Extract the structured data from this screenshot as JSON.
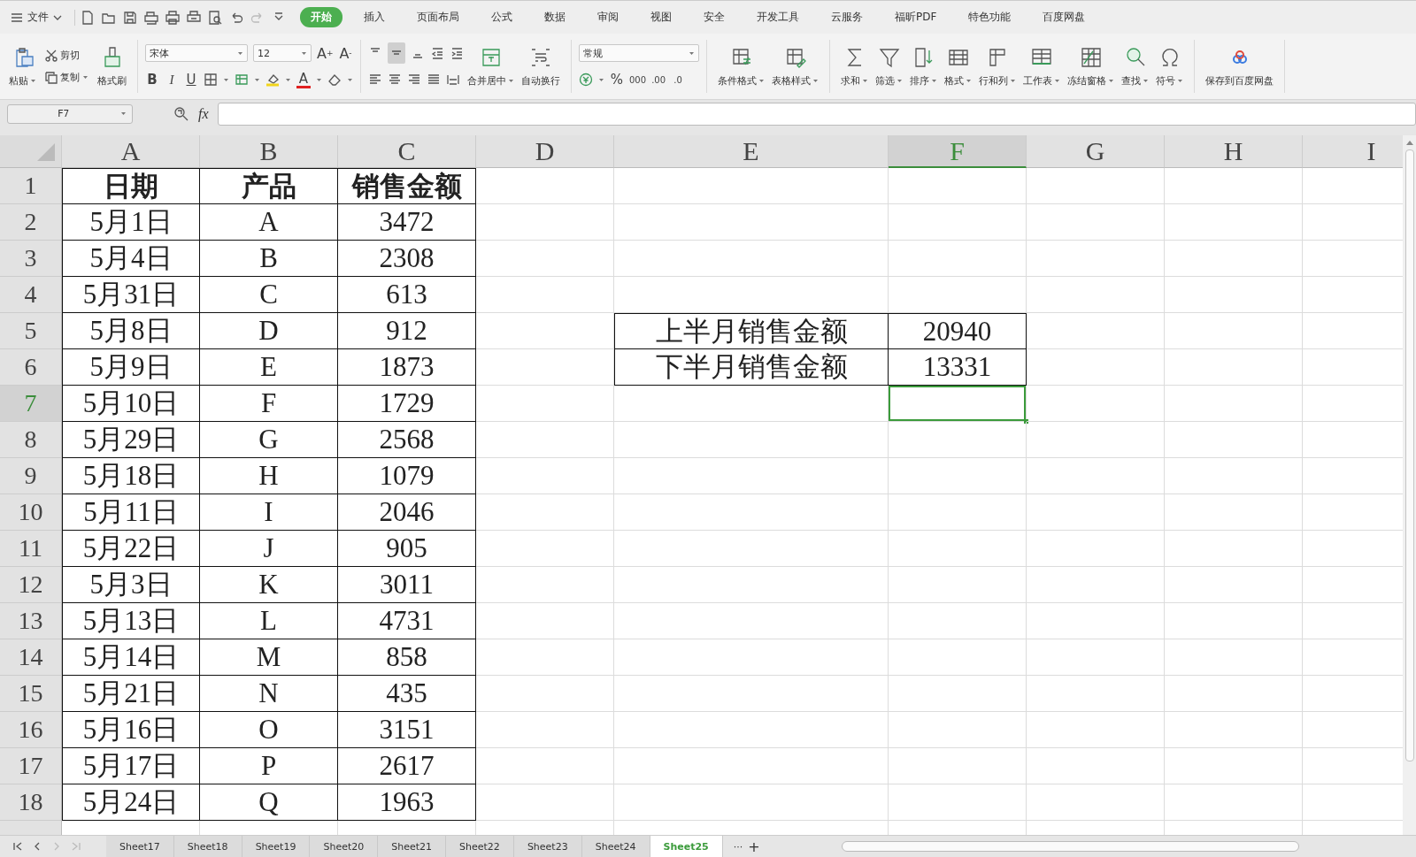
{
  "menu": {
    "file_label": "文件",
    "tabs": [
      {
        "label": "开始",
        "selected": true
      },
      {
        "label": "插入",
        "selected": false
      },
      {
        "label": "页面布局",
        "selected": false
      },
      {
        "label": "公式",
        "selected": false
      },
      {
        "label": "数据",
        "selected": false
      },
      {
        "label": "审阅",
        "selected": false
      },
      {
        "label": "视图",
        "selected": false
      },
      {
        "label": "安全",
        "selected": false
      },
      {
        "label": "开发工具",
        "selected": false
      },
      {
        "label": "云服务",
        "selected": false
      },
      {
        "label": "福昕PDF",
        "selected": false
      },
      {
        "label": "特色功能",
        "selected": false
      },
      {
        "label": "百度网盘",
        "selected": false
      }
    ]
  },
  "toolbar": {
    "paste": "粘贴",
    "cut": "剪切",
    "copy": "复制",
    "format_painter": "格式刷",
    "font_name": "宋体",
    "font_size": "12",
    "grow_font": "A$^{+}$",
    "shrink_font": "A$^{-}$",
    "bold": "B",
    "italic": "I",
    "underline": "U",
    "font_color": "A",
    "merge": "合并居中",
    "wrap": "自动换行",
    "number_format": "常规",
    "percent": "%",
    "thousands": "000",
    "add_decimal": ".00",
    "remove_decimal": ".0",
    "groups": [
      {
        "label": "条件格式",
        "dropdown": true
      },
      {
        "label": "表格样式",
        "dropdown": true
      }
    ],
    "tools": [
      {
        "label": "求和",
        "dropdown": true
      },
      {
        "label": "筛选",
        "dropdown": true
      },
      {
        "label": "排序",
        "dropdown": true
      },
      {
        "label": "格式",
        "dropdown": true
      },
      {
        "label": "行和列",
        "dropdown": true
      },
      {
        "label": "工作表",
        "dropdown": true
      },
      {
        "label": "冻结窗格",
        "dropdown": true
      },
      {
        "label": "查找",
        "dropdown": true
      },
      {
        "label": "符号",
        "dropdown": true
      }
    ],
    "save": "保存到百度网盘"
  },
  "formula_bar": {
    "name_box": "F7",
    "fx": "fx"
  },
  "columns": [
    {
      "label": "A",
      "selected": false
    },
    {
      "label": "B",
      "selected": false
    },
    {
      "label": "C",
      "selected": false
    },
    {
      "label": "D",
      "selected": false
    },
    {
      "label": "E",
      "selected": false
    },
    {
      "label": "F",
      "selected": true
    },
    {
      "label": "G",
      "selected": false
    },
    {
      "label": "H",
      "selected": false
    },
    {
      "label": "I",
      "selected": false
    }
  ],
  "rows": [
    {
      "number": "1",
      "selected": false,
      "kind": "header",
      "table": [
        "日期",
        "产品",
        "销售金额"
      ]
    },
    {
      "number": "2",
      "selected": false,
      "table": [
        "5月1日",
        "A",
        "3472"
      ]
    },
    {
      "number": "3",
      "selected": false,
      "table": [
        "5月4日",
        "B",
        "2308"
      ]
    },
    {
      "number": "4",
      "selected": false,
      "table": [
        "5月31日",
        "C",
        "613"
      ]
    },
    {
      "number": "5",
      "selected": false,
      "table": [
        "5月8日",
        "D",
        "912"
      ],
      "summary": [
        "上半月销售金额",
        "20940"
      ]
    },
    {
      "number": "6",
      "selected": false,
      "table": [
        "5月9日",
        "E",
        "1873"
      ],
      "summary": [
        "下半月销售金额",
        "13331"
      ]
    },
    {
      "number": "7",
      "selected": true,
      "table": [
        "5月10日",
        "F",
        "1729"
      ]
    },
    {
      "number": "8",
      "selected": false,
      "table": [
        "5月29日",
        "G",
        "2568"
      ]
    },
    {
      "number": "9",
      "selected": false,
      "table": [
        "5月18日",
        "H",
        "1079"
      ]
    },
    {
      "number": "10",
      "selected": false,
      "table": [
        "5月11日",
        "I",
        "2046"
      ]
    },
    {
      "number": "11",
      "selected": false,
      "table": [
        "5月22日",
        "J",
        "905"
      ]
    },
    {
      "number": "12",
      "selected": false,
      "table": [
        "5月3日",
        "K",
        "3011"
      ]
    },
    {
      "number": "13",
      "selected": false,
      "table": [
        "5月13日",
        "L",
        "4731"
      ]
    },
    {
      "number": "14",
      "selected": false,
      "table": [
        "5月14日",
        "M",
        "858"
      ]
    },
    {
      "number": "15",
      "selected": false,
      "table": [
        "5月21日",
        "N",
        "435"
      ]
    },
    {
      "number": "16",
      "selected": false,
      "table": [
        "5月16日",
        "O",
        "3151"
      ]
    },
    {
      "number": "17",
      "selected": false,
      "table": [
        "5月17日",
        "P",
        "2617"
      ]
    },
    {
      "number": "18",
      "selected": false,
      "table": [
        "5月24日",
        "Q",
        "1963"
      ]
    }
  ],
  "sheets": [
    {
      "label": "Sheet17",
      "selected": false
    },
    {
      "label": "Sheet18",
      "selected": false
    },
    {
      "label": "Sheet19",
      "selected": false
    },
    {
      "label": "Sheet20",
      "selected": false
    },
    {
      "label": "Sheet21",
      "selected": false
    },
    {
      "label": "Sheet22",
      "selected": false
    },
    {
      "label": "Sheet23",
      "selected": false
    },
    {
      "label": "Sheet24",
      "selected": false
    },
    {
      "label": "Sheet25",
      "selected": true
    }
  ],
  "sheet_more": "···",
  "sheet_add": "+"
}
